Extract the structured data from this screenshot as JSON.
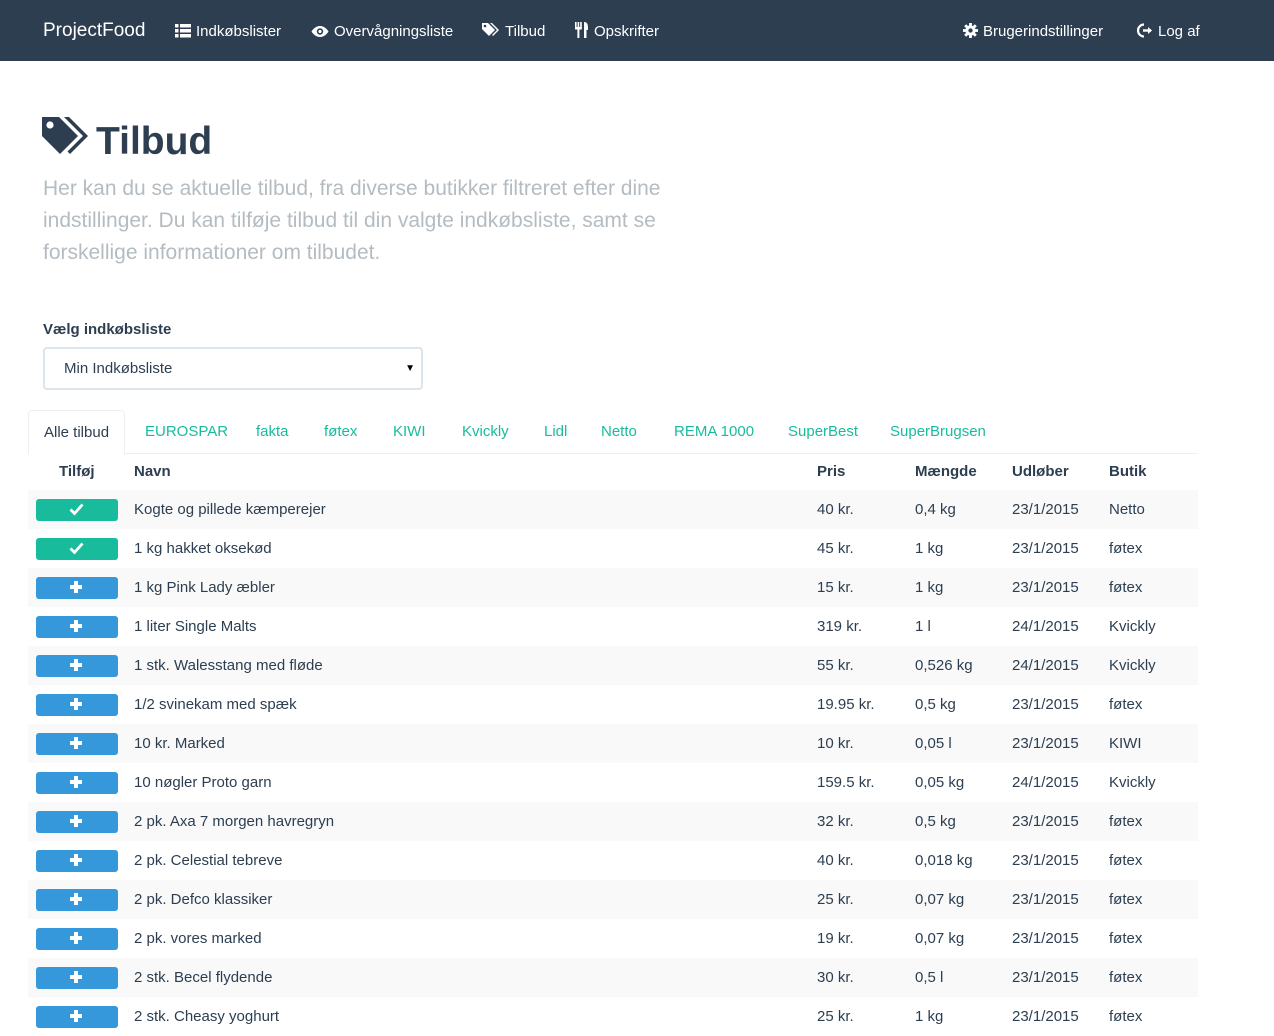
{
  "navbar": {
    "brand": "ProjectFood",
    "items": [
      {
        "label": "Indkøbslister",
        "icon": "list-icon"
      },
      {
        "label": "Overvågningsliste",
        "icon": "eye-icon"
      },
      {
        "label": "Tilbud",
        "icon": "tags-icon"
      },
      {
        "label": "Opskrifter",
        "icon": "cutlery-icon"
      }
    ],
    "right_items": [
      {
        "label": "Brugerindstillinger",
        "icon": "gear-icon"
      },
      {
        "label": "Log af",
        "icon": "log-out-icon"
      }
    ]
  },
  "header": {
    "title": "Tilbud",
    "title_icon": "tags-icon",
    "lead": "Her kan du se aktuelle tilbud, fra diverse butikker filtreret efter dine indstillinger. Du kan tilføje tilbud til din valgte indkøbsliste, samt se forskellige informationer om tilbudet."
  },
  "list_select": {
    "label": "Vælg indkøbsliste",
    "value": "Min Indkøbsliste"
  },
  "tabs": [
    {
      "label": "Alle tilbud",
      "active": true
    },
    {
      "label": "EUROSPAR",
      "active": false
    },
    {
      "label": "fakta",
      "active": false
    },
    {
      "label": "føtex",
      "active": false
    },
    {
      "label": "KIWI",
      "active": false
    },
    {
      "label": "Kvickly",
      "active": false
    },
    {
      "label": "Lidl",
      "active": false
    },
    {
      "label": "Netto",
      "active": false
    },
    {
      "label": "REMA 1000",
      "active": false
    },
    {
      "label": "SuperBest",
      "active": false
    },
    {
      "label": "SuperBrugsen",
      "active": false
    }
  ],
  "table": {
    "columns": [
      "Tilføj",
      "Navn",
      "Pris",
      "Mængde",
      "Udløber",
      "Butik"
    ],
    "rows": [
      {
        "added": true,
        "name": "Kogte og pillede kæmperejer",
        "price": "40 kr.",
        "amount": "0,4 kg",
        "expires": "23/1/2015",
        "store": "Netto"
      },
      {
        "added": true,
        "name": "1 kg hakket oksekød",
        "price": "45 kr.",
        "amount": "1 kg",
        "expires": "23/1/2015",
        "store": "føtex"
      },
      {
        "added": false,
        "name": "1 kg Pink Lady æbler",
        "price": "15 kr.",
        "amount": "1 kg",
        "expires": "23/1/2015",
        "store": "føtex"
      },
      {
        "added": false,
        "name": "1 liter Single Malts",
        "price": "319 kr.",
        "amount": "1 l",
        "expires": "24/1/2015",
        "store": "Kvickly"
      },
      {
        "added": false,
        "name": "1 stk. Walesstang med fløde",
        "price": "55 kr.",
        "amount": "0,526 kg",
        "expires": "24/1/2015",
        "store": "Kvickly"
      },
      {
        "added": false,
        "name": "1/2 svinekam med spæk",
        "price": "19.95 kr.",
        "amount": "0,5 kg",
        "expires": "23/1/2015",
        "store": "føtex"
      },
      {
        "added": false,
        "name": "10 kr. Marked",
        "price": "10 kr.",
        "amount": "0,05 l",
        "expires": "23/1/2015",
        "store": "KIWI"
      },
      {
        "added": false,
        "name": "10 nøgler Proto garn",
        "price": "159.5 kr.",
        "amount": "0,05 kg",
        "expires": "24/1/2015",
        "store": "Kvickly"
      },
      {
        "added": false,
        "name": "2 pk. Axa 7 morgen havregryn",
        "price": "32 kr.",
        "amount": "0,5 kg",
        "expires": "23/1/2015",
        "store": "føtex"
      },
      {
        "added": false,
        "name": "2 pk. Celestial tebreve",
        "price": "40 kr.",
        "amount": "0,018 kg",
        "expires": "23/1/2015",
        "store": "føtex"
      },
      {
        "added": false,
        "name": "2 pk. Defco klassiker",
        "price": "25 kr.",
        "amount": "0,07 kg",
        "expires": "23/1/2015",
        "store": "føtex"
      },
      {
        "added": false,
        "name": "2 pk. vores marked",
        "price": "19 kr.",
        "amount": "0,07 kg",
        "expires": "23/1/2015",
        "store": "føtex"
      },
      {
        "added": false,
        "name": "2 stk. Becel flydende",
        "price": "30 kr.",
        "amount": "0,5 l",
        "expires": "23/1/2015",
        "store": "føtex"
      },
      {
        "added": false,
        "name": "2 stk. Cheasy yoghurt",
        "price": "25 kr.",
        "amount": "1 kg",
        "expires": "23/1/2015",
        "store": "føtex"
      }
    ]
  },
  "colors": {
    "navbar_bg": "#2c3e50",
    "added_button": "#18bc9c",
    "add_button": "#3498db",
    "tab_link": "#18bc9c",
    "lead_text": "#b4bcc2"
  }
}
